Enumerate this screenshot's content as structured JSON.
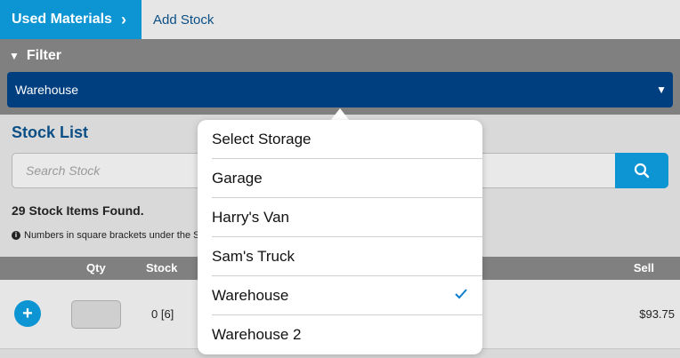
{
  "tabs": {
    "active_label": "Used Materials",
    "second_label": "Add Stock"
  },
  "filter": {
    "title": "Filter",
    "selected": "Warehouse"
  },
  "stock": {
    "title": "Stock List",
    "search_placeholder": "Search Stock",
    "count_text": "29 Stock Items Found.",
    "note_text": "Numbers in square brackets under the S"
  },
  "table": {
    "headers": {
      "qty": "Qty",
      "stock": "Stock",
      "sell": "Sell"
    },
    "rows": [
      {
        "stock": "0 [6]",
        "sell": "$93.75"
      }
    ]
  },
  "storage_popover": {
    "options": [
      "Select Storage",
      "Garage",
      "Harry's Van",
      "Sam's Truck",
      "Warehouse",
      "Warehouse 2"
    ],
    "checked": "Warehouse"
  },
  "colors": {
    "accent": "#0d94d2",
    "navy": "#003f7f",
    "title": "#0b4f86"
  },
  "icons": [
    "chevron-right-icon",
    "triangle-down-icon",
    "search-icon",
    "info-icon",
    "plus-icon",
    "checkmark-icon"
  ]
}
